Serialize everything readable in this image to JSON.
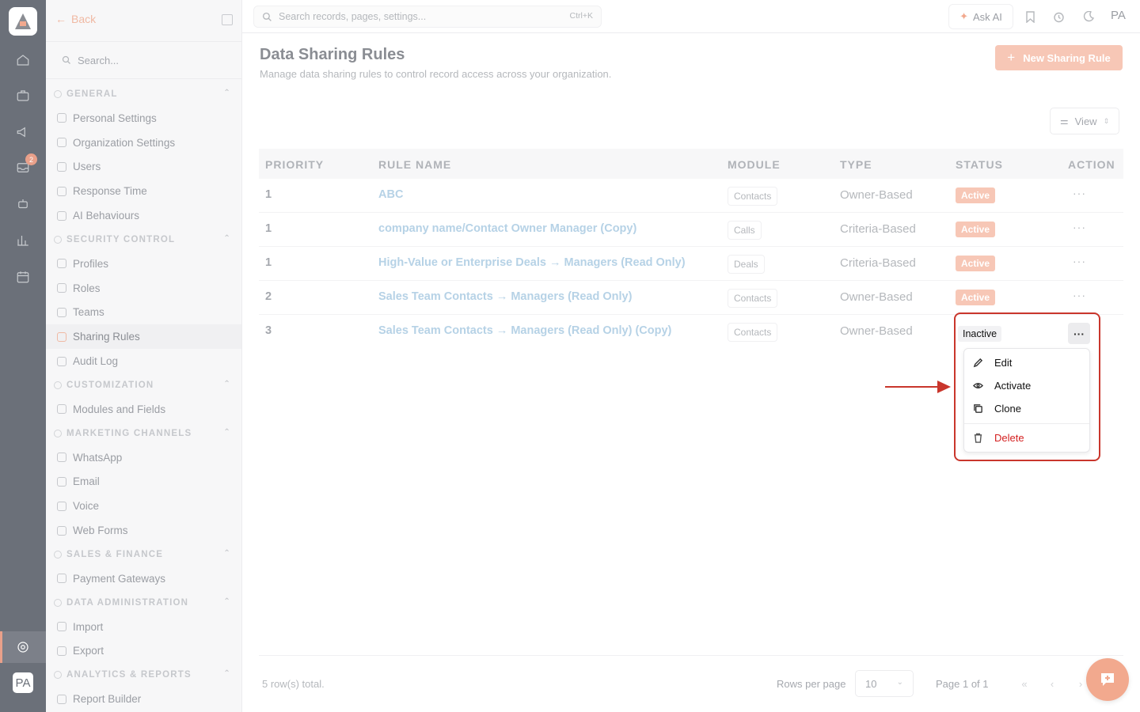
{
  "rail": {
    "badge_count": "2",
    "avatar": "PA",
    "icons": [
      "home-icon",
      "briefcase-icon",
      "megaphone-icon",
      "inbox-icon",
      "robot-icon",
      "chart-icon",
      "calendar-icon",
      "settings-icon"
    ]
  },
  "sidebar": {
    "back_label": "Back",
    "search_placeholder": "Search...",
    "sections": [
      {
        "title": "GENERAL",
        "items": [
          "Personal Settings",
          "Organization Settings",
          "Users",
          "Response Time",
          "AI Behaviours"
        ]
      },
      {
        "title": "SECURITY CONTROL",
        "items": [
          "Profiles",
          "Roles",
          "Teams",
          "Sharing Rules",
          "Audit Log"
        ]
      },
      {
        "title": "CUSTOMIZATION",
        "items": [
          "Modules and Fields"
        ]
      },
      {
        "title": "MARKETING CHANNELS",
        "items": [
          "WhatsApp",
          "Email",
          "Voice",
          "Web Forms"
        ]
      },
      {
        "title": "SALES & FINANCE",
        "items": [
          "Payment Gateways"
        ]
      },
      {
        "title": "DATA ADMINISTRATION",
        "items": [
          "Import",
          "Export"
        ]
      },
      {
        "title": "ANALYTICS & REPORTS",
        "items": [
          "Report Builder"
        ]
      }
    ],
    "active_item": "Sharing Rules"
  },
  "topbar": {
    "search_placeholder": "Search records, pages, settings...",
    "shortcut": "Ctrl+K",
    "ask_ai": "Ask AI",
    "user_initials": "PA"
  },
  "page": {
    "title": "Data Sharing Rules",
    "subtitle": "Manage data sharing rules to control record access across your organization.",
    "new_button": "New Sharing Rule",
    "view_button": "View"
  },
  "table": {
    "headers": [
      "PRIORITY",
      "RULE NAME",
      "MODULE",
      "TYPE",
      "STATUS",
      "ACTION"
    ],
    "rows": [
      {
        "priority": "1",
        "name": "ABC",
        "module": "Contacts",
        "type": "Owner-Based",
        "status": "Active",
        "action": "···"
      },
      {
        "priority": "1",
        "name": "company name/Contact Owner Manager (Copy)",
        "module": "Calls",
        "type": "Criteria-Based",
        "status": "Active",
        "action": "···"
      },
      {
        "priority": "1",
        "name": "High-Value or Enterprise Deals → Managers (Read Only)",
        "module": "Deals",
        "type": "Criteria-Based",
        "status": "Active",
        "action": "···"
      },
      {
        "priority": "2",
        "name": "Sales Team Contacts → Managers (Read Only)",
        "module": "Contacts",
        "type": "Owner-Based",
        "status": "Active",
        "action": "···"
      },
      {
        "priority": "3",
        "name": "Sales Team Contacts → Managers (Read Only) (Copy)",
        "module": "Contacts",
        "type": "Owner-Based",
        "status": "Inactive",
        "action": "···"
      }
    ]
  },
  "action_menu": {
    "items": [
      "Edit",
      "Activate",
      "Clone"
    ],
    "delete": "Delete"
  },
  "footer": {
    "total": "5 row(s) total.",
    "rows_per_page_label": "Rows per page",
    "rows_per_page_value": "10",
    "page_info": "Page 1 of 1",
    "first": "«",
    "prev": "‹",
    "next": "›"
  },
  "colors": {
    "accent": "#f2a98e",
    "highlight": "#c9362c",
    "delete": "#d42020",
    "link": "#b6d2e6"
  }
}
